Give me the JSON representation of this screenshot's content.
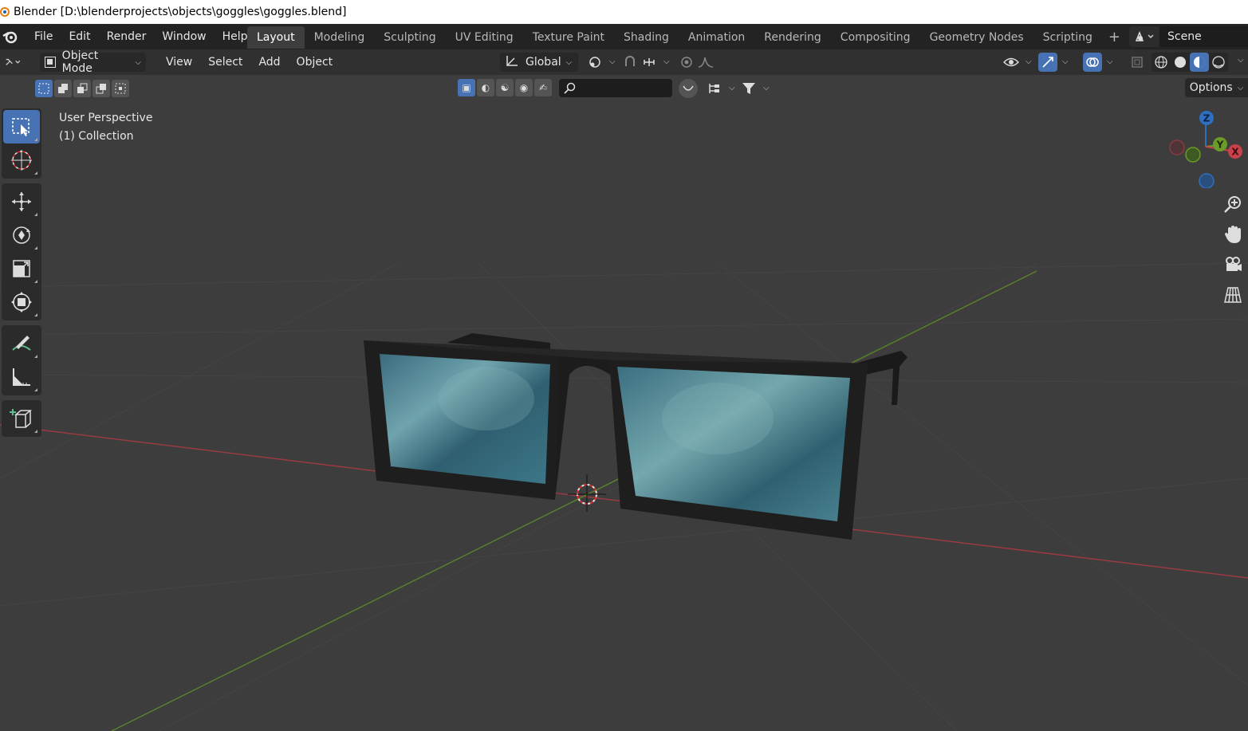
{
  "window": {
    "title": "Blender [D:\\blenderprojects\\objects\\goggles\\goggles.blend]"
  },
  "menu": [
    "File",
    "Edit",
    "Render",
    "Window",
    "Help"
  ],
  "workspaces": {
    "tabs": [
      "Layout",
      "Modeling",
      "Sculpting",
      "UV Editing",
      "Texture Paint",
      "Shading",
      "Animation",
      "Rendering",
      "Compositing",
      "Geometry Nodes",
      "Scripting"
    ],
    "active": "Layout"
  },
  "scene": {
    "name": "Scene"
  },
  "viewport_header": {
    "mode": "Object Mode",
    "menus": [
      "View",
      "Select",
      "Add",
      "Object"
    ],
    "transform_orientation": "Global",
    "options_label": "Options"
  },
  "viewport": {
    "perspective_label": "User Perspective",
    "collection_label": "(1) Collection"
  },
  "gizmo": {
    "z": "Z",
    "y": "Y",
    "x": "X"
  },
  "colors": {
    "accent": "#4772b3",
    "x_axis": "#c8414b",
    "y_axis": "#6a9a2a",
    "z_axis": "#2f6fc0",
    "lens": "#3f6f78"
  },
  "icons": {
    "toolbar": [
      "select-box-icon",
      "cursor-icon",
      "move-icon",
      "rotate-icon",
      "scale-icon",
      "transform-icon",
      "annotate-icon",
      "measure-icon",
      "add-cube-icon"
    ],
    "nav": [
      "zoom-icon",
      "pan-hand-icon",
      "camera-icon",
      "grid-view-icon"
    ]
  }
}
